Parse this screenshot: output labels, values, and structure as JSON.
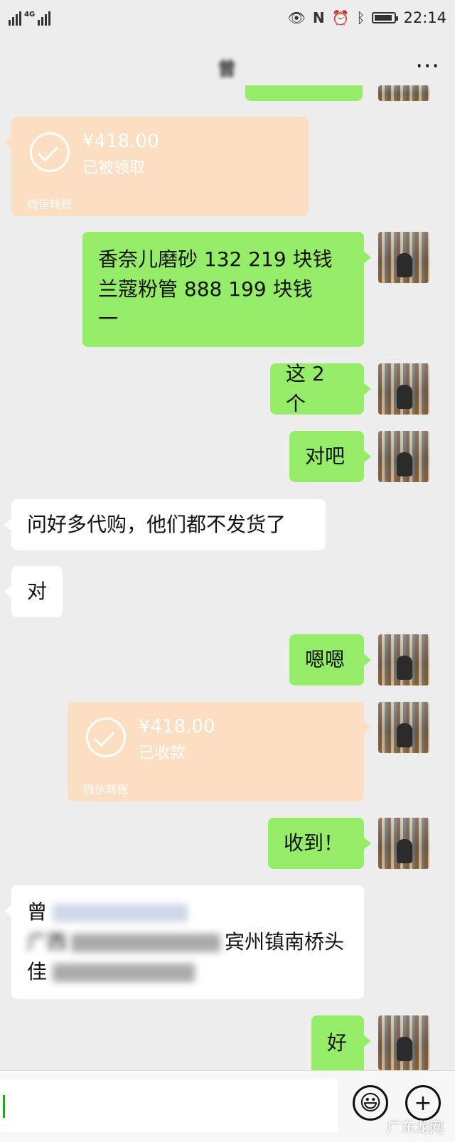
{
  "status_bar": {
    "network": "4G",
    "time": "22:14",
    "battery_level": 0.9,
    "icons": [
      "signal-icon",
      "eye-icon",
      "nfc-icon",
      "alarm-icon",
      "bluetooth-icon",
      "battery-icon"
    ]
  },
  "header": {
    "title": "曾",
    "more_label": "⋯"
  },
  "messages": [
    {
      "type": "transfer",
      "side": "left",
      "amount": "¥418.00",
      "status": "已被领取",
      "footer": "微信转账"
    },
    {
      "type": "text",
      "side": "right",
      "lines": [
        "香奈儿磨砂 132   219 块钱",
        "兰蔻粉管 888   199 块钱",
        "一"
      ]
    },
    {
      "type": "text",
      "side": "right",
      "text": "这 2 个"
    },
    {
      "type": "text",
      "side": "right",
      "text": "对吧"
    },
    {
      "type": "text",
      "side": "left",
      "text": "问好多代购，他们都不发货了"
    },
    {
      "type": "text",
      "side": "left",
      "text": "对"
    },
    {
      "type": "text",
      "side": "right",
      "text": "嗯嗯"
    },
    {
      "type": "transfer",
      "side": "right",
      "amount": "¥418.00",
      "status": "已收款",
      "footer": "微信转账"
    },
    {
      "type": "text",
      "side": "right",
      "text": "收到！"
    },
    {
      "type": "text",
      "side": "left",
      "lines": [
        "曾",
        "广西",
        "宾州镇南桥头",
        "佳"
      ],
      "blurred": true
    },
    {
      "type": "text",
      "side": "right",
      "text": "好"
    }
  ],
  "composer": {
    "emoji_label": "😃",
    "plus_label": "+"
  },
  "watermark": "广东龙网"
}
